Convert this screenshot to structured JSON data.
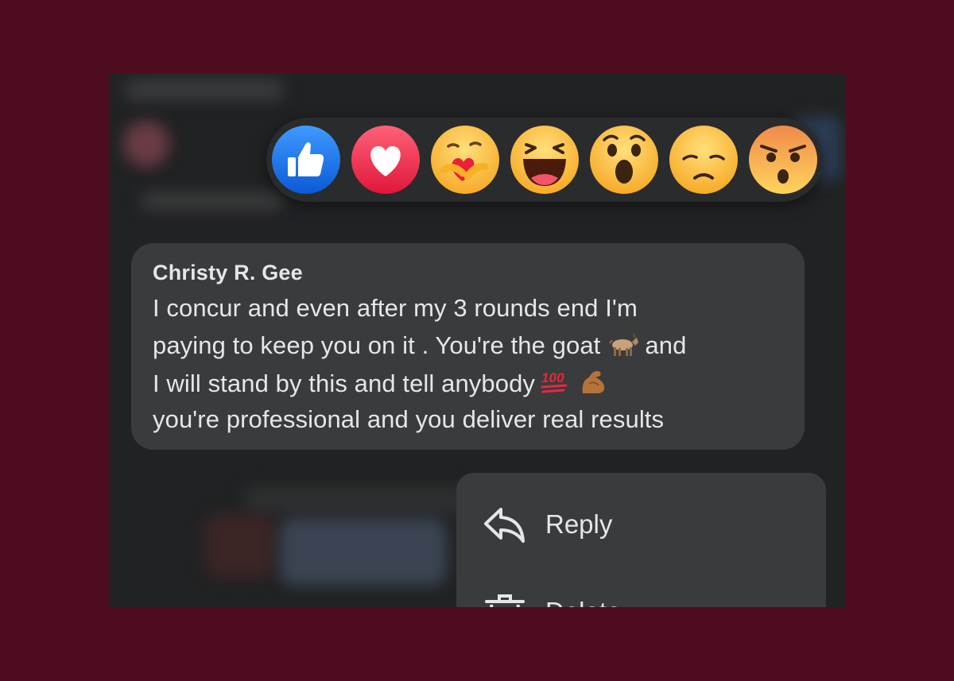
{
  "reactions": [
    {
      "name": "like",
      "icon": "thumbs-up-icon",
      "color": "#1877f2"
    },
    {
      "name": "love",
      "icon": "heart-icon",
      "color": "#f33e58"
    },
    {
      "name": "care",
      "icon": "care-emoji-icon",
      "color": "#f7b125"
    },
    {
      "name": "haha",
      "icon": "laughing-emoji-icon",
      "color": "#f7b125"
    },
    {
      "name": "wow",
      "icon": "surprised-emoji-icon",
      "color": "#f7b125"
    },
    {
      "name": "sad",
      "icon": "sad-emoji-icon",
      "color": "#f7b125"
    },
    {
      "name": "angry",
      "icon": "angry-emoji-icon",
      "color": "#f7b125"
    }
  ],
  "comment": {
    "author": "Christy R. Gee",
    "line1": "I concur and even after my 3 rounds end I'm",
    "line2_a": "paying to keep you on it . You're the goat",
    "line2_b": "and",
    "line3_a": "I will stand by this and tell anybody",
    "line4": "you're professional and you deliver real results",
    "emojis": [
      "goat-emoji-icon",
      "hundred-points-emoji-icon",
      "flexed-biceps-emoji-icon"
    ]
  },
  "menu": {
    "reply_label": "Reply",
    "delete_label": "Delete"
  },
  "colors": {
    "page_background": "#4e0d1f",
    "panel_background": "#212223",
    "bubble": "#3a3b3c",
    "text": "#e4e6eb"
  }
}
